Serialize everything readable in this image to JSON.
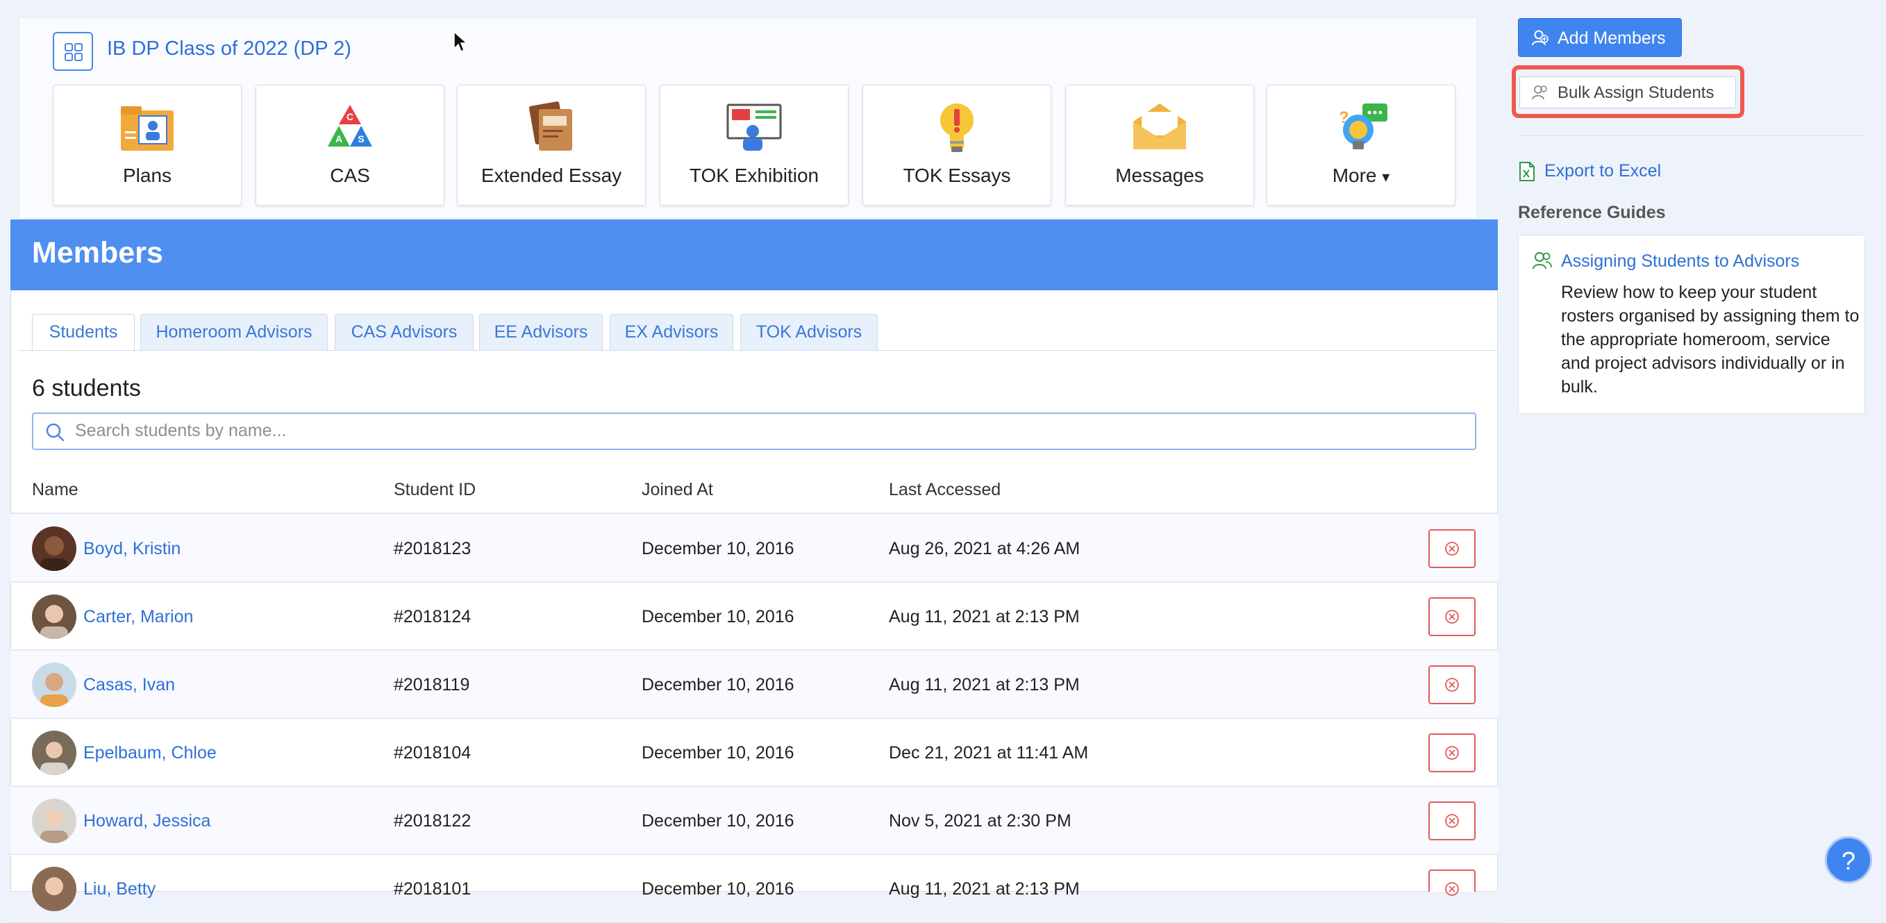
{
  "class": {
    "title": "IB DP Class of 2022 (DP 2)"
  },
  "tiles": [
    {
      "label": "Plans",
      "icon": "folder-plans-icon"
    },
    {
      "label": "CAS",
      "icon": "cas-triangle-icon"
    },
    {
      "label": "Extended Essay",
      "icon": "books-icon"
    },
    {
      "label": "TOK Exhibition",
      "icon": "presentation-icon"
    },
    {
      "label": "TOK Essays",
      "icon": "lightbulb-icon"
    },
    {
      "label": "Messages",
      "icon": "envelope-icon"
    },
    {
      "label": "More",
      "icon": "help-bulb-icon",
      "caret": "▾"
    }
  ],
  "cas_letters": {
    "top": "C",
    "left": "A",
    "right": "S"
  },
  "members": {
    "title": "Members",
    "tabs": [
      "Students",
      "Homeroom Advisors",
      "CAS Advisors",
      "EE Advisors",
      "EX Advisors",
      "TOK Advisors"
    ],
    "active_tab": "Students",
    "count_text": "6 students",
    "search_placeholder": "Search students by name...",
    "columns": {
      "name": "Name",
      "student_id": "Student ID",
      "joined_at": "Joined At",
      "last_accessed": "Last Accessed"
    },
    "rows": [
      {
        "name": "Boyd, Kristin",
        "student_id": "#2018123",
        "joined_at": "December 10, 2016",
        "last_accessed": "Aug 26, 2021 at 4:26 AM"
      },
      {
        "name": "Carter, Marion",
        "student_id": "#2018124",
        "joined_at": "December 10, 2016",
        "last_accessed": "Aug 11, 2021 at 2:13 PM"
      },
      {
        "name": "Casas, Ivan",
        "student_id": "#2018119",
        "joined_at": "December 10, 2016",
        "last_accessed": "Aug 11, 2021 at 2:13 PM"
      },
      {
        "name": "Epelbaum, Chloe",
        "student_id": "#2018104",
        "joined_at": "December 10, 2016",
        "last_accessed": "Dec 21, 2021 at 11:41 AM"
      },
      {
        "name": "Howard, Jessica",
        "student_id": "#2018122",
        "joined_at": "December 10, 2016",
        "last_accessed": "Nov 5, 2021 at 2:30 PM"
      },
      {
        "name": "Liu, Betty",
        "student_id": "#2018101",
        "joined_at": "December 10, 2016",
        "last_accessed": "Aug 11, 2021 at 2:13 PM"
      }
    ]
  },
  "sidebar": {
    "add_members": "Add Members",
    "bulk_assign": "Bulk Assign Students",
    "export": "Export to Excel",
    "reference_heading": "Reference Guides",
    "guide_title": "Assigning Students to Advisors",
    "guide_desc": "Review how to keep your student rosters organised by assigning them to the appropriate homeroom, service and project advisors individually or in bulk."
  },
  "help": {
    "label": "?"
  },
  "colors": {
    "accent": "#4e8ff0",
    "link": "#2f6fd6",
    "danger": "#e25b5b",
    "highlight": "#f0584f"
  }
}
